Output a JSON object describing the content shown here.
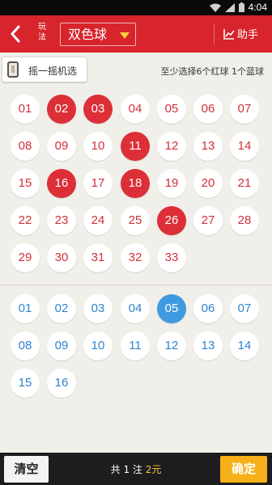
{
  "status_bar": {
    "time": "4:04"
  },
  "header": {
    "back_icon": "chevron-left-icon",
    "play_label": "玩法",
    "game_name": "双色球",
    "helper_label": "助手",
    "helper_icon": "chart-icon",
    "brand_color": "#d8242c"
  },
  "toolbar": {
    "shake_label": "摇一摇机选",
    "hint": "至少选择6个红球 1个蓝球"
  },
  "red_balls": [
    {
      "num": "01",
      "sel": false
    },
    {
      "num": "02",
      "sel": true
    },
    {
      "num": "03",
      "sel": true
    },
    {
      "num": "04",
      "sel": false
    },
    {
      "num": "05",
      "sel": false
    },
    {
      "num": "06",
      "sel": false
    },
    {
      "num": "07",
      "sel": false
    },
    {
      "num": "08",
      "sel": false
    },
    {
      "num": "09",
      "sel": false
    },
    {
      "num": "10",
      "sel": false
    },
    {
      "num": "11",
      "sel": true
    },
    {
      "num": "12",
      "sel": false
    },
    {
      "num": "13",
      "sel": false
    },
    {
      "num": "14",
      "sel": false
    },
    {
      "num": "15",
      "sel": false
    },
    {
      "num": "16",
      "sel": true
    },
    {
      "num": "17",
      "sel": false
    },
    {
      "num": "18",
      "sel": true
    },
    {
      "num": "19",
      "sel": false
    },
    {
      "num": "20",
      "sel": false
    },
    {
      "num": "21",
      "sel": false
    },
    {
      "num": "22",
      "sel": false
    },
    {
      "num": "23",
      "sel": false
    },
    {
      "num": "24",
      "sel": false
    },
    {
      "num": "25",
      "sel": false
    },
    {
      "num": "26",
      "sel": true
    },
    {
      "num": "27",
      "sel": false
    },
    {
      "num": "28",
      "sel": false
    },
    {
      "num": "29",
      "sel": false
    },
    {
      "num": "30",
      "sel": false
    },
    {
      "num": "31",
      "sel": false
    },
    {
      "num": "32",
      "sel": false
    },
    {
      "num": "33",
      "sel": false
    }
  ],
  "blue_balls": [
    {
      "num": "01",
      "sel": false
    },
    {
      "num": "02",
      "sel": false
    },
    {
      "num": "03",
      "sel": false
    },
    {
      "num": "04",
      "sel": false
    },
    {
      "num": "05",
      "sel": true
    },
    {
      "num": "06",
      "sel": false
    },
    {
      "num": "07",
      "sel": false
    },
    {
      "num": "08",
      "sel": false
    },
    {
      "num": "09",
      "sel": false
    },
    {
      "num": "10",
      "sel": false
    },
    {
      "num": "11",
      "sel": false
    },
    {
      "num": "12",
      "sel": false
    },
    {
      "num": "13",
      "sel": false
    },
    {
      "num": "14",
      "sel": false
    },
    {
      "num": "15",
      "sel": false
    },
    {
      "num": "16",
      "sel": false
    }
  ],
  "bottom_bar": {
    "clear_label": "清空",
    "summary_prefix": "共",
    "bet_count": "1",
    "bet_unit": "注",
    "amount": "2元",
    "confirm_label": "确定"
  }
}
